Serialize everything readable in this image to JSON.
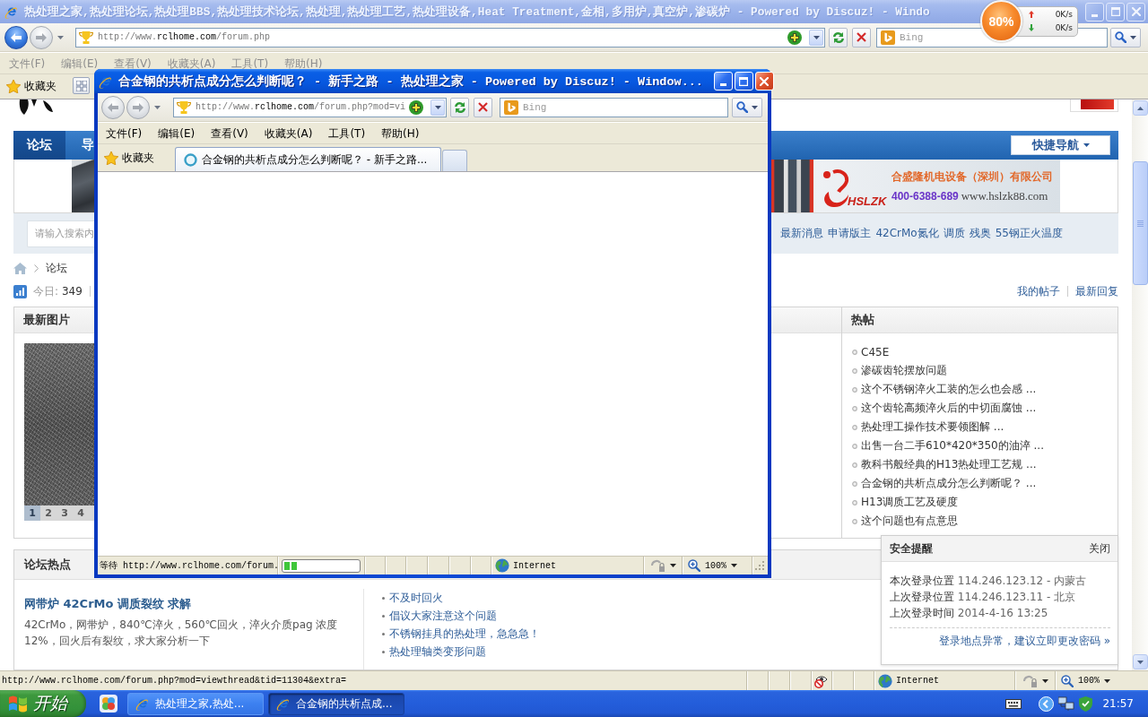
{
  "main_window": {
    "title": "热处理之家,热处理论坛,热处理BBS,热处理技术论坛,热处理,热处理工艺,热处理设备,Heat Treatment,金相,多用炉,真空炉,渗碳炉 - Powered by Discuz! - Windo",
    "active": false,
    "back_disabled": false,
    "forward_disabled": true,
    "address": {
      "scheme": "http://www.",
      "domain": "rclhome.com",
      "path": "/forum.php"
    },
    "search_placeholder": "Bing",
    "menu": [
      "文件(F)",
      "编辑(E)",
      "查看(V)",
      "收藏夹(A)",
      "工具(T)",
      "帮助(H)"
    ],
    "favorites": "收藏夹",
    "status": {
      "text": "http://www.rclhome.com/forum.php?mod=viewthread&tid=11304&extra=",
      "zone": "Internet",
      "zoom": "100%"
    }
  },
  "monitor_widget": {
    "percent": "80%",
    "upload": "0K/s",
    "download": "0K/s"
  },
  "page": {
    "nav": [
      {
        "label": "论坛",
        "selected": true
      },
      {
        "label": "导",
        "selected": false
      }
    ],
    "quick_nav": "快捷导航",
    "ad": {
      "brand": "HSLZK",
      "company": "合盛隆机电设备（深圳）有限公司",
      "phone": "400-6388-689",
      "url": "www.hslzk88.com"
    },
    "search_placeholder": "请输入搜索内",
    "hot_searches": [
      "最新消息",
      "申请版主",
      "42CrMo氮化",
      "调质",
      "残奥",
      "55钢正火温度"
    ],
    "breadcrumb": "论坛",
    "stats": {
      "label": "今日:",
      "count": "349"
    },
    "my_links": [
      "我的帖子",
      "最新回复"
    ],
    "latest_images": {
      "title": "最新图片",
      "pages": [
        {
          "label": "1",
          "selected": true
        },
        {
          "label": "2",
          "selected": false
        },
        {
          "label": "3",
          "selected": false
        },
        {
          "label": "4",
          "selected": false
        }
      ]
    },
    "hot_posts": {
      "title": "热帖",
      "items": [
        "C45E",
        "渗碳齿轮摆放问题",
        "这个不锈钢淬火工装的怎么也会感 ...",
        "这个齿轮高频淬火后的中切面腐蚀 ...",
        "热处理工操作技术要领图解 ...",
        "出售一台二手610*420*350的油淬 ...",
        "教科书般经典的H13热处理工艺规 ...",
        "合金钢的共析点成分怎么判断呢？ ...",
        "H13调质工艺及硬度",
        "这个问题也有点意思"
      ]
    },
    "forum_hot": {
      "title": "论坛热点",
      "featured": {
        "title": "网带炉 42CrMo 调质裂纹 求解",
        "summary": "42CrMo，网带炉，840℃淬火，560℃回火，淬火介质pag 浓度 12%，回火后有裂纹，求大家分析一下"
      },
      "links": [
        "不及时回火",
        "倡议大家注意这个问题",
        "不锈钢挂具的热处理，急急急！",
        "热处理轴类变形问题"
      ]
    },
    "security_alert": {
      "title": "安全提醒",
      "close": "关闭",
      "lines": [
        {
          "label": "本次登录位置",
          "value": "114.246.123.12 - 内蒙古"
        },
        {
          "label": "上次登录位置",
          "value": "114.246.123.11 - 北京"
        },
        {
          "label": "上次登录时间",
          "value": "2014-4-16 13:25"
        }
      ],
      "link": "登录地点异常，建议立即更改密码 »"
    }
  },
  "popup_window": {
    "title": "合金钢的共析点成分怎么判断呢？ - 新手之路 - 热处理之家 - Powered by Discuz! - Window...",
    "active": true,
    "back_disabled": true,
    "forward_disabled": true,
    "address": {
      "scheme": "http://www.",
      "domain": "rclhome.com",
      "path": "/forum.php?mod=vi"
    },
    "search_placeholder": "Bing",
    "menu": [
      "文件(F)",
      "编辑(E)",
      "查看(V)",
      "收藏夹(A)",
      "工具(T)",
      "帮助(H)"
    ],
    "favorites": "收藏夹",
    "tabs": [
      {
        "label": "合金钢的共析点成分怎么判断呢？ - 新手之路...",
        "selected": true
      }
    ],
    "status": {
      "text": "等待 http://www.rclhome.com/forum.",
      "level": 0.17,
      "zone": "Internet",
      "zoom": "100%"
    }
  },
  "taskbar": {
    "start": "开始",
    "tasks": [
      {
        "label": "热处理之家,热处...",
        "selected": false
      },
      {
        "label": "合金钢的共析点成...",
        "selected": true
      }
    ],
    "clock": "21:57"
  }
}
